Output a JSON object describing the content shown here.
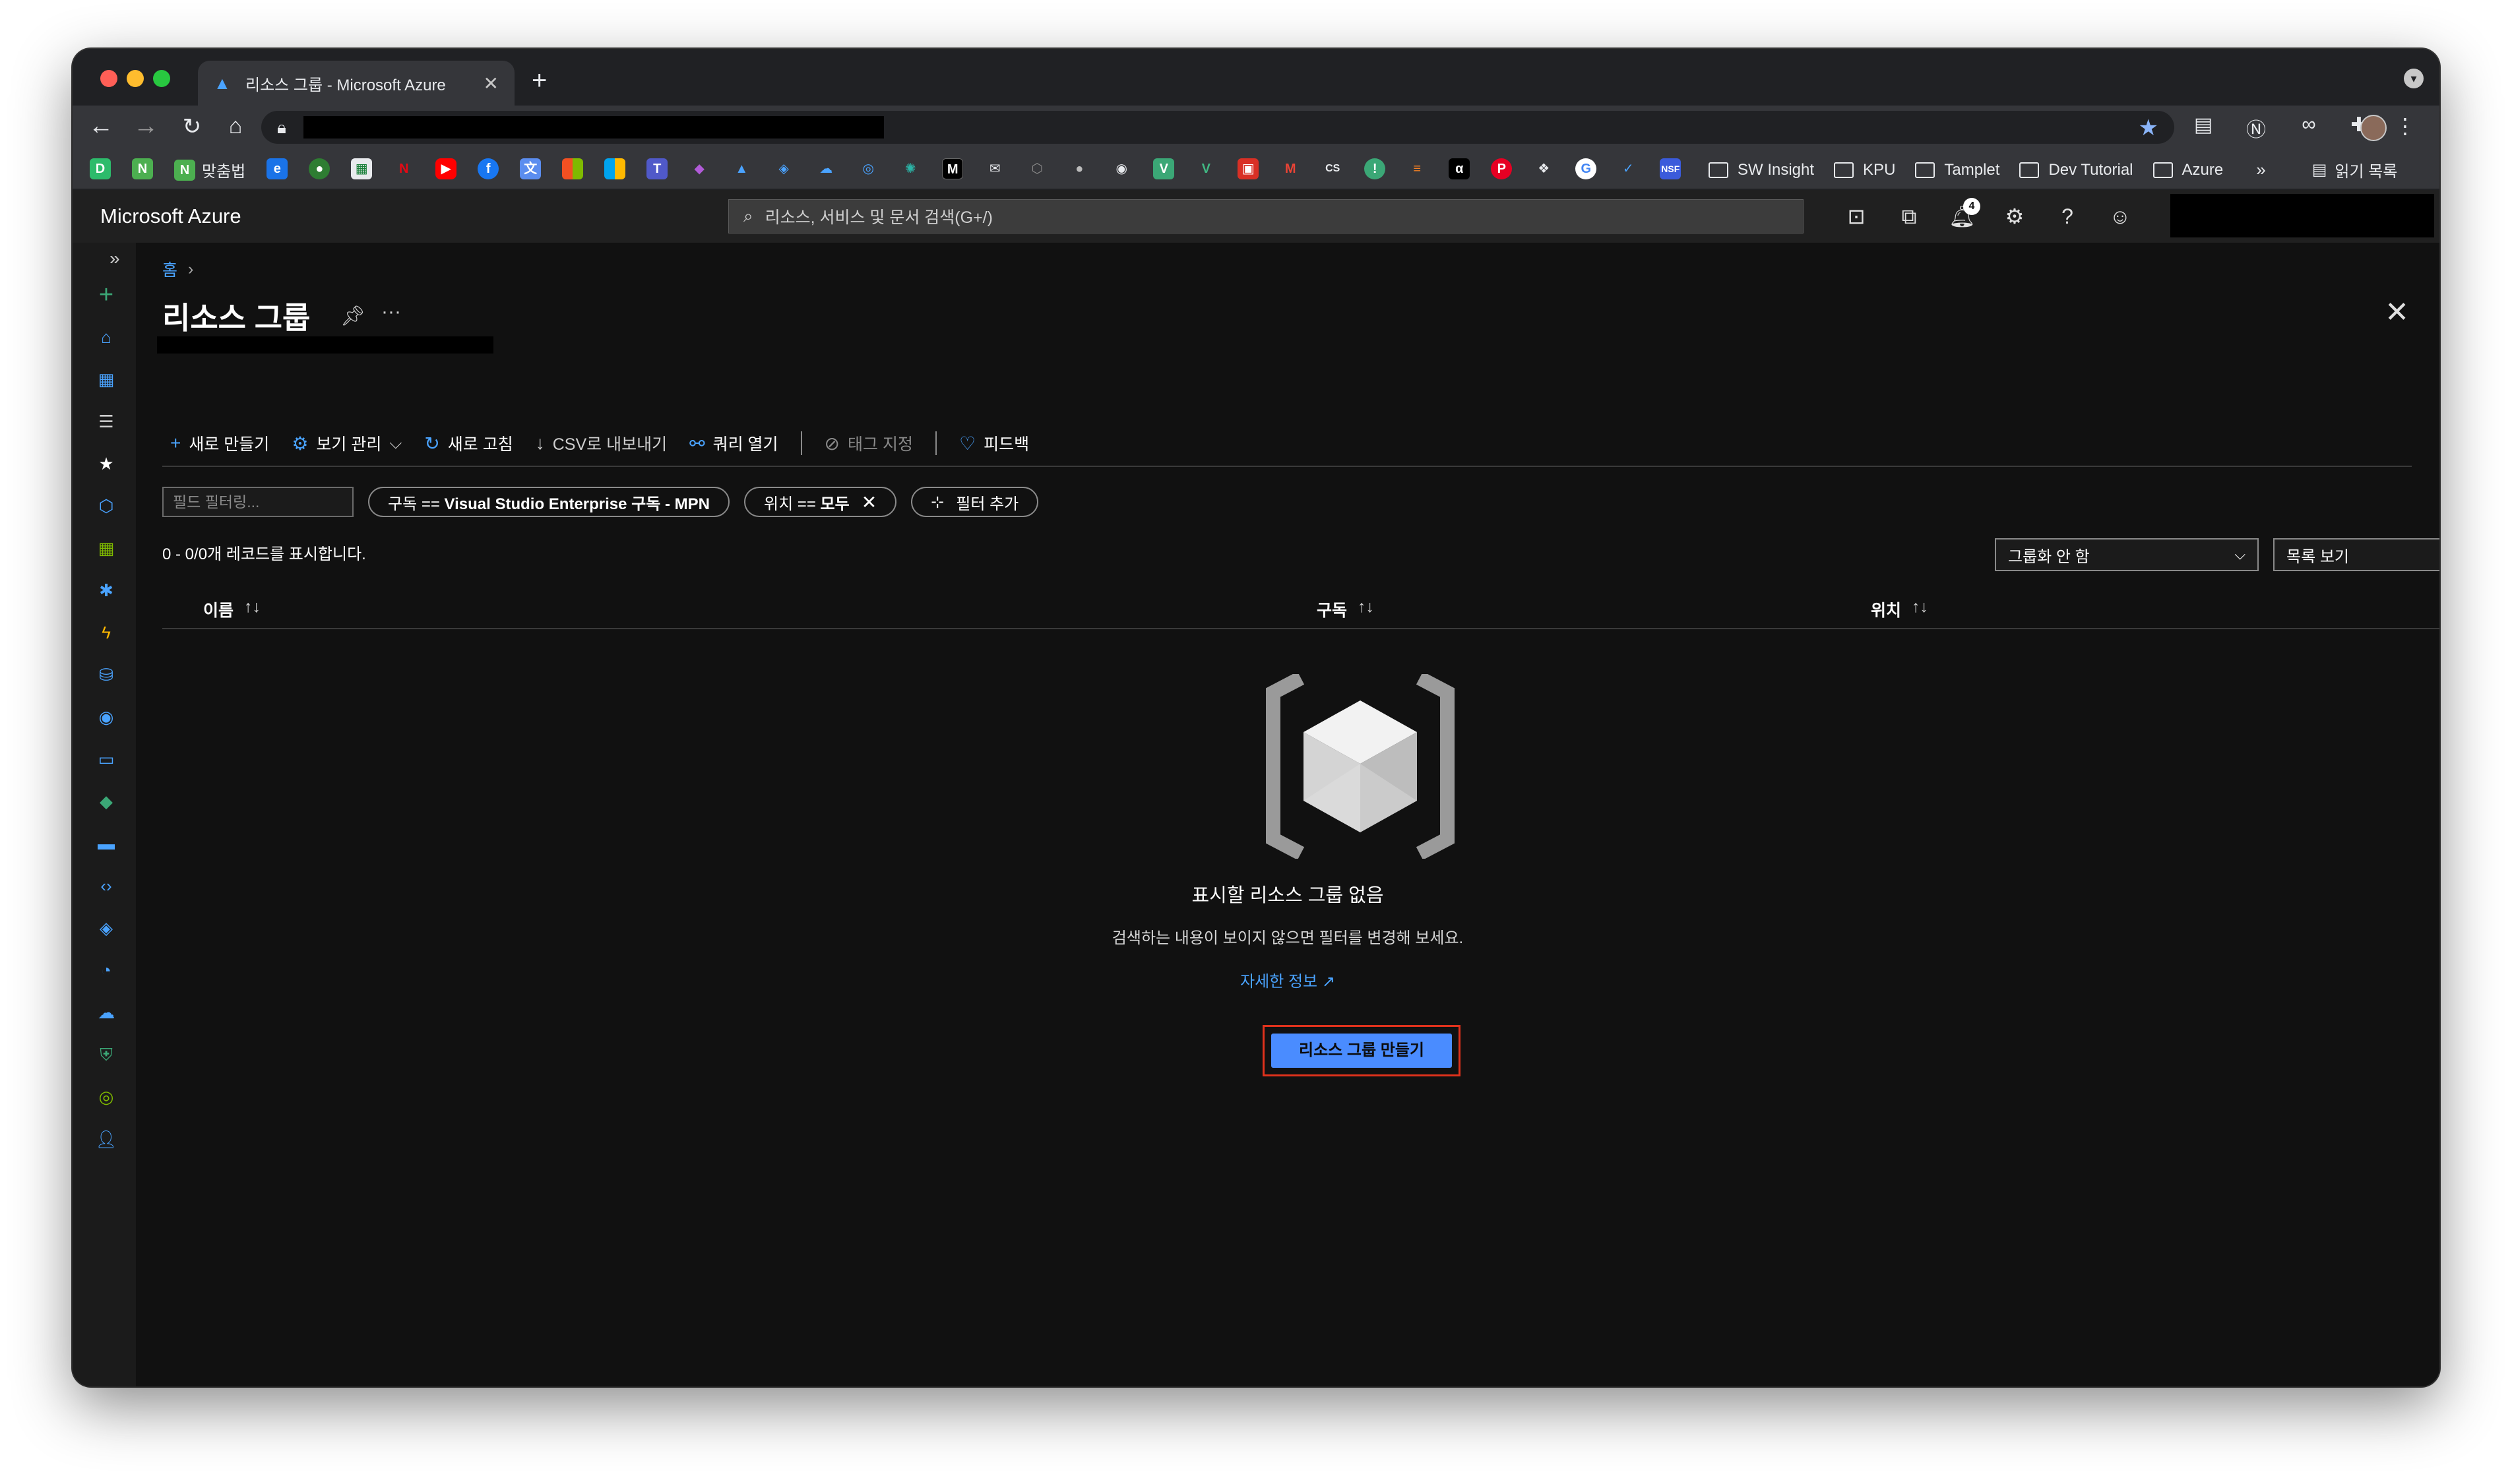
{
  "browser": {
    "tab_title": "리소스 그룹 - Microsoft Azure",
    "new_tab_symbol": "+",
    "bookmark_folders": [
      {
        "label": "SW Insight"
      },
      {
        "label": "KPU"
      },
      {
        "label": "Tamplet"
      },
      {
        "label": "Dev Tutorial"
      },
      {
        "label": "Azure"
      }
    ],
    "bookmark_first_label": "맞춤법",
    "bookmarks_overflow": "»",
    "reading_list": "읽기 목록"
  },
  "azure": {
    "brand": "Microsoft Azure",
    "search_placeholder": "리소스, 서비스 및 문서 검색(G+/)",
    "notification_count": "4"
  },
  "page": {
    "breadcrumb_home": "홈",
    "title": "리소스 그룹",
    "commands": {
      "create": "새로 만들기",
      "manage_view": "보기 관리",
      "refresh": "새로 고침",
      "export_csv": "CSV로 내보내기",
      "open_query": "쿼리 열기",
      "assign_tags": "태그 지정",
      "feedback": "피드백"
    },
    "filters": {
      "field_placeholder": "필드 필터링...",
      "subscription_key": "구독 == ",
      "subscription_value": "Visual Studio Enterprise 구독 - MPN",
      "location_key": "위치 == ",
      "location_value": "모두",
      "add_filter": "필터 추가"
    },
    "record_count": "0 - 0/0개 레코드를 표시합니다.",
    "grouping_select": "그룹화 안 함",
    "view_select": "목록 보기",
    "columns": {
      "name": "이름",
      "subscription": "구독",
      "location": "위치"
    },
    "empty_state": {
      "title": "표시할 리소스 그룹 없음",
      "description": "검색하는 내용이 보이지 않으면 필터를 변경해 보세요.",
      "learn_more": "자세한 정보",
      "create_button": "리소스 그룹 만들기"
    }
  },
  "colors": {
    "accent": "#4aa3ff",
    "cta": "#4a8cff",
    "highlight_border": "#e0321c",
    "background": "#111111"
  }
}
